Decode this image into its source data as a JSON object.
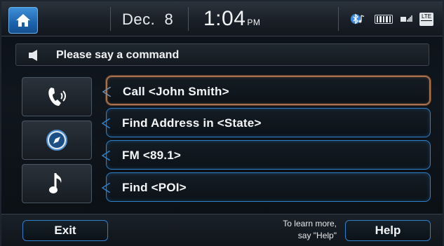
{
  "status_bar": {
    "date": "Dec.  8",
    "time": "1:04",
    "ampm": "PM",
    "icons": [
      "bluetooth-audio-icon",
      "battery-icon",
      "signal-icon",
      "lte-icon"
    ],
    "lte_label": "LTE"
  },
  "prompt": {
    "text": "Please say a command"
  },
  "side_tiles": [
    {
      "icon": "phone-icon"
    },
    {
      "icon": "compass-icon"
    },
    {
      "icon": "music-note-icon"
    }
  ],
  "commands": [
    {
      "label": "Call <John Smith>",
      "selected": true
    },
    {
      "label": "Find Address in <State>",
      "selected": false
    },
    {
      "label": "FM <89.1>",
      "selected": false
    },
    {
      "label": "Find <POI>",
      "selected": false
    }
  ],
  "bottom_bar": {
    "exit_label": "Exit",
    "hint_line1": "To learn more,",
    "hint_line2": "say \"Help\"",
    "help_label": "Help"
  },
  "colors": {
    "accent_blue": "#2e7fcc",
    "selection_highlight": "#a8724e",
    "home_button": "#1d63ad"
  }
}
